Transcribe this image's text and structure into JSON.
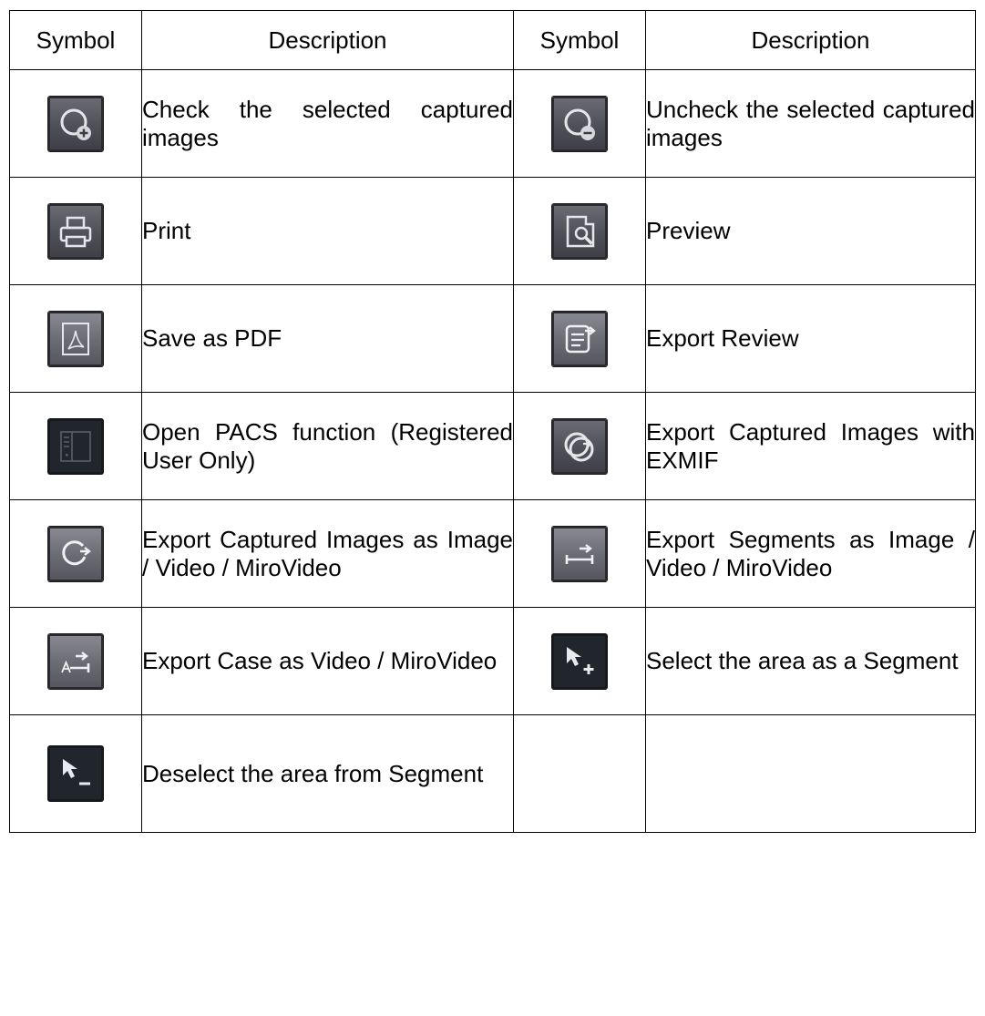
{
  "table": {
    "headers": [
      "Symbol",
      "Description",
      "Symbol",
      "Description"
    ],
    "rows": [
      [
        {
          "icon": "check-image-plus-icon",
          "description": "Check the selected captured images"
        },
        {
          "icon": "uncheck-image-minus-icon",
          "description": "Uncheck the selected captured images"
        }
      ],
      [
        {
          "icon": "printer-icon",
          "description": "Print"
        },
        {
          "icon": "preview-document-magnifier-icon",
          "description": "Preview"
        }
      ],
      [
        {
          "icon": "pdf-document-icon",
          "description": "Save as PDF"
        },
        {
          "icon": "export-review-icon",
          "description": "Export Review"
        }
      ],
      [
        {
          "icon": "pacs-panel-icon",
          "description": "Open PACS function (Registered User Only)"
        },
        {
          "icon": "export-images-exmif-icon",
          "description": "Export Captured Images with EXMIF"
        }
      ],
      [
        {
          "icon": "export-images-arrow-icon",
          "description": "Export Captured Images as Image / Video / MiroVideo"
        },
        {
          "icon": "export-segments-icon",
          "description": "Export Segments as Image / Video / MiroVideo"
        }
      ],
      [
        {
          "icon": "export-case-icon",
          "description": "Export Case as Video / MiroVideo"
        },
        {
          "icon": "select-area-plus-icon",
          "description": "Select the area as a Segment"
        }
      ],
      [
        {
          "icon": "deselect-area-minus-icon",
          "description": "Deselect the area from Segment"
        },
        null
      ]
    ]
  }
}
